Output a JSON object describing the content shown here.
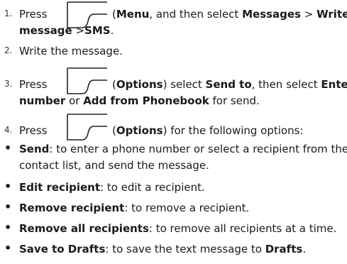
{
  "steps": [
    {
      "num": "1.",
      "press": "Press",
      "key_label": "Menu",
      "rest_a": ", and then select ",
      "b1": "Messages",
      "sep1": " > ",
      "b2": "Write",
      "line2_b": "message",
      "line2_sep": " >",
      "line2_b2": "SMS",
      "line2_end": "."
    },
    {
      "num": "2.",
      "text": "Write the message."
    },
    {
      "num": "3.",
      "press": "Press",
      "key_label": "Options",
      "rest_a": " select ",
      "b1": "Send to",
      "rest_b": ", then select ",
      "b2": "Enter",
      "line2_b": "number",
      "line2_mid": " or ",
      "line2_b2": "Add from Phonebook",
      "line2_end": " for send."
    },
    {
      "num": "4.",
      "press": "Press",
      "key_label": "Options",
      "rest_a": " for the following options:"
    }
  ],
  "bullets": [
    {
      "term": "Send",
      "desc": ": to enter a phone number or select a recipient from the",
      "desc2": "contact list, and send the message."
    },
    {
      "term": "Edit recipient",
      "desc": ": to edit a recipient."
    },
    {
      "term": "Remove recipient",
      "desc": ": to remove a recipient."
    },
    {
      "term": "Remove all recipients",
      "desc": ": to remove all recipients at a time."
    },
    {
      "term": "Save to Drafts",
      "desc": ": to save the text message to ",
      "desc_b": "Drafts",
      "desc_end": "."
    }
  ],
  "icons": {
    "softkey": "left-softkey-icon"
  }
}
